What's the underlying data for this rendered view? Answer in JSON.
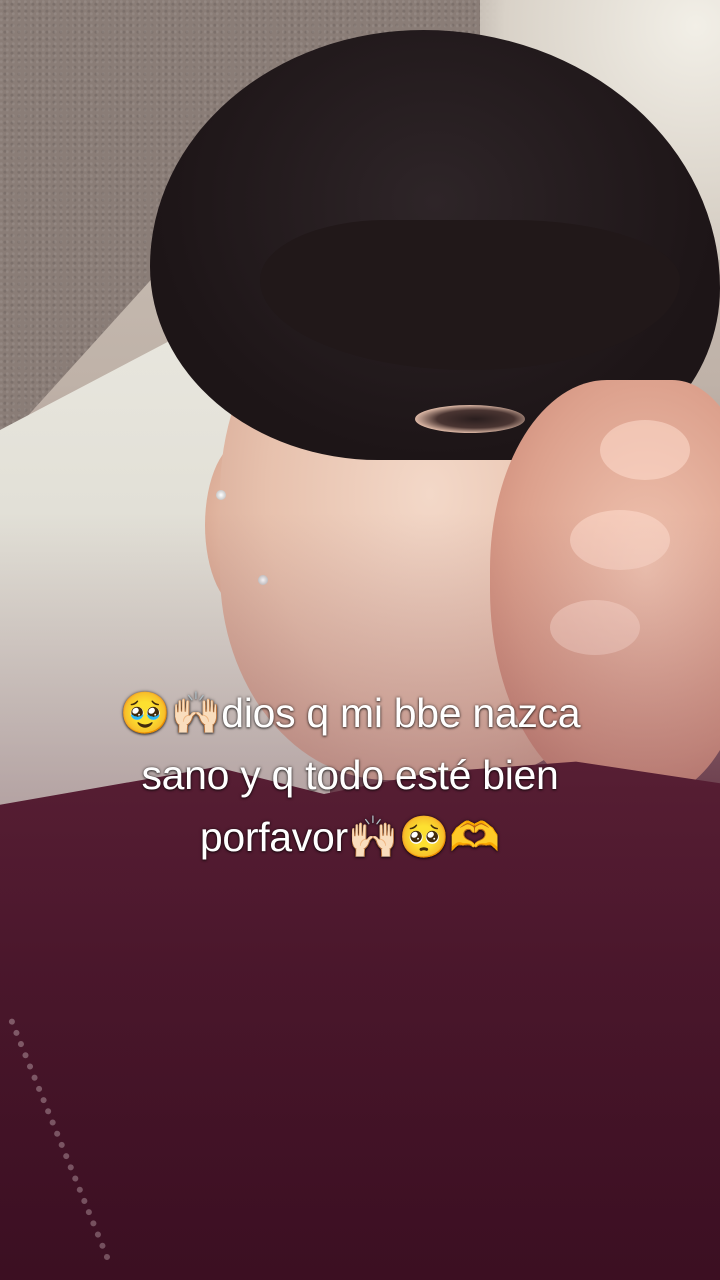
{
  "caption": {
    "line1": "🥹🙌🏻dios q mi bbe nazca",
    "line2": "sano y q todo esté bien",
    "line3": "porfavor🙌🏻🥺🫶"
  },
  "background": {
    "subject": "selfie-photo"
  },
  "colors": {
    "caption_text": "#ffffff",
    "shirt": "#4a1a2a",
    "hair": "#1d1517"
  }
}
